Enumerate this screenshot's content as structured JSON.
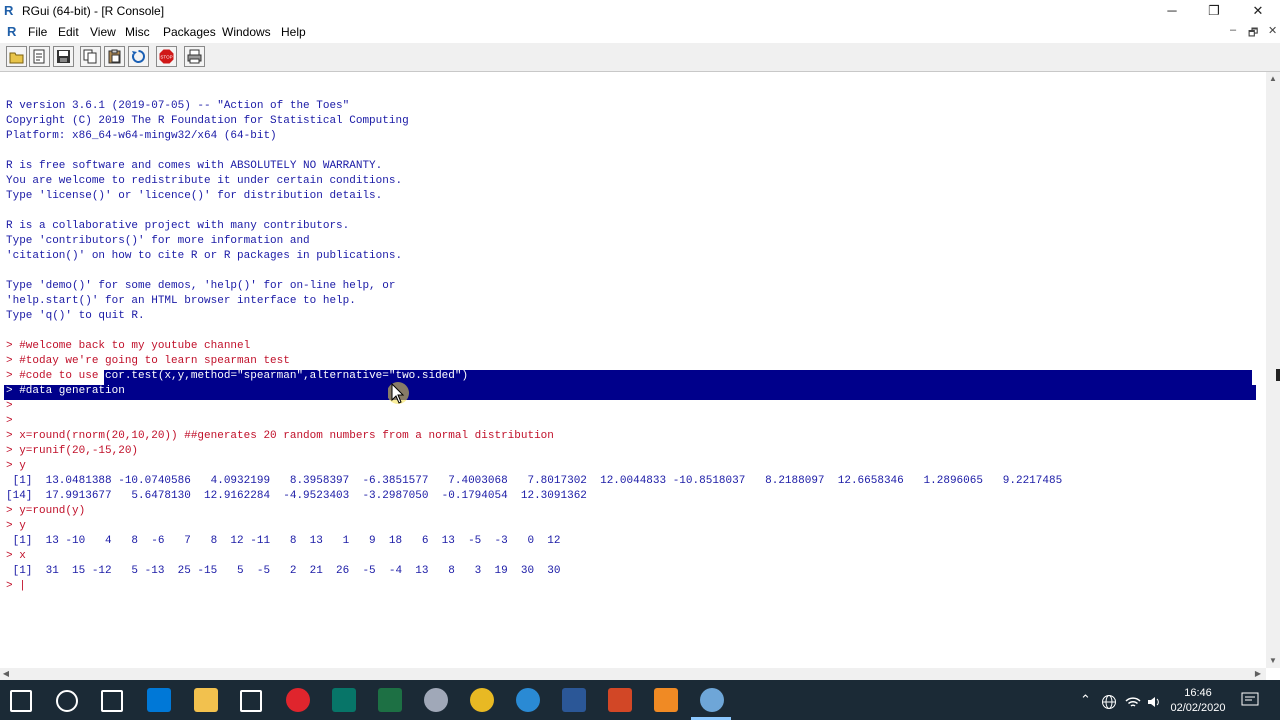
{
  "window": {
    "title": "RGui (64-bit) - [R Console]",
    "logo": "R",
    "controls": [
      "─",
      "❐",
      "✕"
    ]
  },
  "menubar": {
    "items": [
      "File",
      "Edit",
      "View",
      "Misc",
      "Packages",
      "Windows",
      "Help"
    ],
    "mdi_controls": [
      "–",
      "🗗",
      "✕"
    ]
  },
  "toolbar": {
    "buttons": [
      "open-script-icon",
      "load-workspace-icon",
      "save-workspace-icon",
      "copy-icon",
      "paste-icon",
      "copy-paste-icon",
      "stop-icon",
      "print-icon"
    ],
    "stop_label": "STOP"
  },
  "console": {
    "lines": [
      {
        "text": "R version 3.6.1 (2019-07-05) -- \"Action of the Toes\"",
        "kind": "out"
      },
      {
        "text": "Copyright (C) 2019 The R Foundation for Statistical Computing",
        "kind": "out"
      },
      {
        "text": "Platform: x86_64-w64-mingw32/x64 (64-bit)",
        "kind": "out"
      },
      {
        "text": "",
        "kind": "out"
      },
      {
        "text": "R is free software and comes with ABSOLUTELY NO WARRANTY.",
        "kind": "out"
      },
      {
        "text": "You are welcome to redistribute it under certain conditions.",
        "kind": "out"
      },
      {
        "text": "Type 'license()' or 'licence()' for distribution details.",
        "kind": "out"
      },
      {
        "text": "",
        "kind": "out"
      },
      {
        "text": "R is a collaborative project with many contributors.",
        "kind": "out"
      },
      {
        "text": "Type 'contributors()' for more information and",
        "kind": "out"
      },
      {
        "text": "'citation()' on how to cite R or R packages in publications.",
        "kind": "out"
      },
      {
        "text": "",
        "kind": "out"
      },
      {
        "text": "Type 'demo()' for some demos, 'help()' for on-line help, or",
        "kind": "out"
      },
      {
        "text": "'help.start()' for an HTML browser interface to help.",
        "kind": "out"
      },
      {
        "text": "Type 'q()' to quit R.",
        "kind": "out"
      },
      {
        "text": "",
        "kind": "out"
      },
      {
        "text": "> #welcome back to my youtube channel",
        "kind": "in"
      },
      {
        "text": "> #today we're going to learn spearman test",
        "kind": "in"
      },
      {
        "text": "> #code to use cor.test(x,y,method=\"spearman\",alternative=\"two.sided\")",
        "kind": "in-sel",
        "sel_from": 15
      },
      {
        "text": "> #data generation",
        "kind": "sel"
      },
      {
        "text": ">",
        "kind": "in"
      },
      {
        "text": ">",
        "kind": "in"
      },
      {
        "text": "> x=round(rnorm(20,10,20)) ##generates 20 random numbers from a normal distribution",
        "kind": "in"
      },
      {
        "text": "> y=runif(20,-15,20)",
        "kind": "in"
      },
      {
        "text": "> y",
        "kind": "in"
      },
      {
        "text": " [1]  13.0481388 -10.0740586   4.0932199   8.3958397  -6.3851577   7.4003068   7.8017302  12.0044833 -10.8518037   8.2188097  12.6658346   1.2896065   9.2217485",
        "kind": "out"
      },
      {
        "text": "[14]  17.9913677   5.6478130  12.9162284  -4.9523403  -3.2987050  -0.1794054  12.3091362",
        "kind": "out"
      },
      {
        "text": "> y=round(y)",
        "kind": "in"
      },
      {
        "text": "> y",
        "kind": "in"
      },
      {
        "text": " [1]  13 -10   4   8  -6   7   8  12 -11   8  13   1   9  18   6  13  -5  -3   0  12",
        "kind": "out"
      },
      {
        "text": "> x",
        "kind": "in"
      },
      {
        "text": " [1]  31  15 -12   5 -13  25 -15   5  -5   2  21  26  -5  -4  13   8   3  19  30  30",
        "kind": "out"
      },
      {
        "text": "> |",
        "kind": "in"
      }
    ]
  },
  "taskbar": {
    "icons": [
      {
        "name": "start-icon",
        "color": "#ffffff"
      },
      {
        "name": "search-icon",
        "color": "#ffffff"
      },
      {
        "name": "task-view-icon",
        "color": "#ffffff"
      },
      {
        "name": "store-icon",
        "color": "#0078d7"
      },
      {
        "name": "file-explorer-icon",
        "color": "#f2c14e"
      },
      {
        "name": "mail-icon",
        "color": "#ffffff"
      },
      {
        "name": "opera-icon",
        "color": "#e0252d"
      },
      {
        "name": "publisher-icon",
        "color": "#077568"
      },
      {
        "name": "excel-icon",
        "color": "#1d7044"
      },
      {
        "name": "cortana-icon",
        "color": "#a0a8b8"
      },
      {
        "name": "chrome-icon",
        "color": "#e8b923"
      },
      {
        "name": "edge-icon",
        "color": "#2a8ad4"
      },
      {
        "name": "word-icon",
        "color": "#2b5797"
      },
      {
        "name": "powerpoint-icon",
        "color": "#d24726"
      },
      {
        "name": "paint-icon",
        "color": "#f08a24"
      },
      {
        "name": "rgui-icon",
        "color": "#6ea6d8"
      }
    ],
    "tray_icons": [
      "chevron-up-icon",
      "network-globe-icon",
      "wifi-icon",
      "volume-icon"
    ],
    "time": "16:46",
    "date": "02/02/2020"
  }
}
